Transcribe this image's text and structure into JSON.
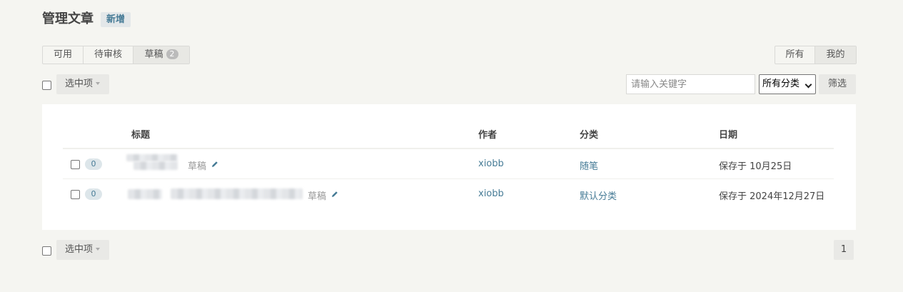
{
  "header": {
    "title": "管理文章",
    "new_label": "新增"
  },
  "tabs": [
    {
      "label": "可用"
    },
    {
      "label": "待审核"
    },
    {
      "label": "草稿",
      "count": "2"
    }
  ],
  "scope": {
    "all_label": "所有",
    "mine_label": "我的"
  },
  "ops": {
    "select_label": "选中项"
  },
  "search": {
    "placeholder": "请输入关键字",
    "value": ""
  },
  "category_filter": {
    "selected": "所有分类"
  },
  "filter_label": "筛选",
  "table": {
    "headers": {
      "title": "标题",
      "author": "作者",
      "category": "分类",
      "date": "日期"
    },
    "rows": [
      {
        "comments": "0",
        "status": "草稿",
        "author": "xiobb",
        "category": "随笔",
        "date": "保存于 10月25日"
      },
      {
        "comments": "0",
        "status": "草稿",
        "author": "xiobb",
        "category": "默认分类",
        "date": "保存于 2024年12月27日"
      }
    ]
  },
  "pagination": {
    "current": "1"
  },
  "colors": {
    "accent": "#467b96",
    "background": "#f5f5f1"
  }
}
